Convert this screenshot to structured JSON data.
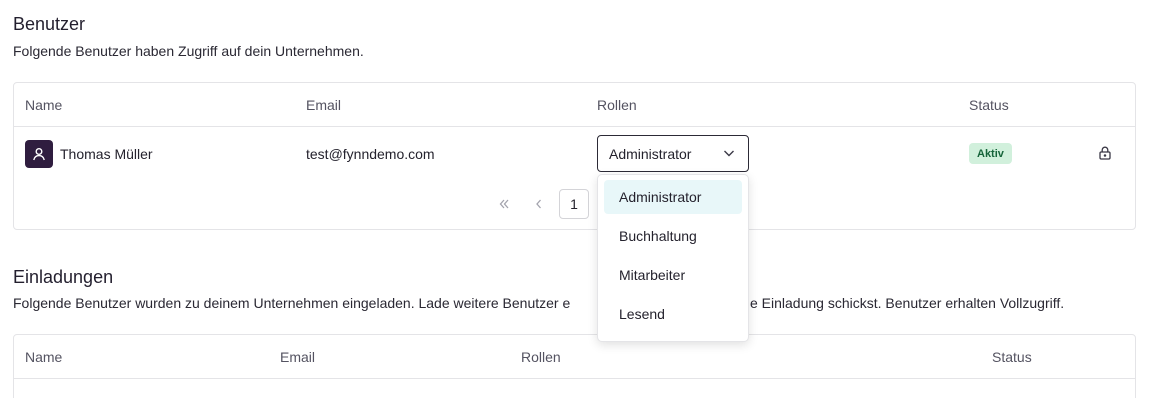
{
  "users_section": {
    "title": "Benutzer",
    "description": "Folgende Benutzer haben Zugriff auf dein Unternehmen.",
    "columns": {
      "name": "Name",
      "email": "Email",
      "roles": "Rollen",
      "status": "Status"
    },
    "rows": [
      {
        "name": "Thomas Müller",
        "email": "test@fynndemo.com",
        "role": "Administrator",
        "status": "Aktiv",
        "avatar_icon": "user-icon",
        "action_icon": "lock-icon"
      }
    ],
    "pagination": {
      "first_icon": "double-chevron-left-icon",
      "prev_icon": "chevron-left-icon",
      "current_page": "1"
    }
  },
  "role_dropdown": {
    "options": [
      "Administrator",
      "Buchhaltung",
      "Mitarbeiter",
      "Lesend"
    ],
    "highlighted": "Administrator"
  },
  "invites_section": {
    "title": "Einladungen",
    "description_left": "Folgende Benutzer wurden zu deinem Unternehmen eingeladen. Lade weitere Benutzer e",
    "description_right": "e Einladung schickst. Benutzer erhalten Vollzugriff.",
    "columns": {
      "name": "Name",
      "email": "Email",
      "roles": "Rollen",
      "status": "Status"
    }
  },
  "colors": {
    "avatar_bg": "#2f1d3f",
    "badge_bg": "#d1f0dc",
    "badge_text": "#16643a",
    "highlight": "#e8f7f9"
  }
}
